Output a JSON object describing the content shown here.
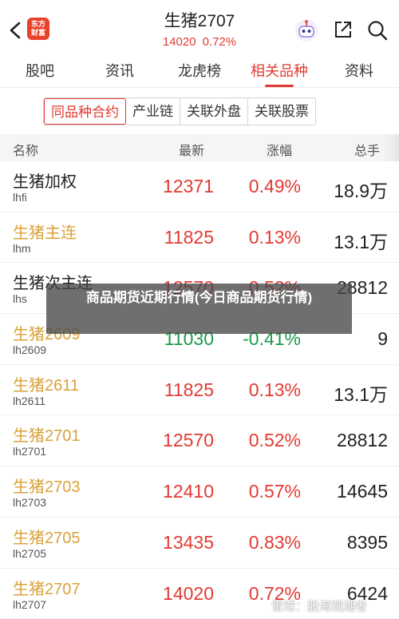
{
  "header": {
    "title": "生猪2707",
    "price": "14020",
    "change": "0.72%",
    "logo_text": "东方财富"
  },
  "tabs": [
    {
      "label": "股吧",
      "active": false
    },
    {
      "label": "资讯",
      "active": false
    },
    {
      "label": "龙虎榜",
      "active": false
    },
    {
      "label": "相关品种",
      "active": true
    },
    {
      "label": "资料",
      "active": false
    }
  ],
  "subtabs": [
    {
      "label": "同品种合约",
      "active": true
    },
    {
      "label": "产业链",
      "active": false
    },
    {
      "label": "关联外盘",
      "active": false
    },
    {
      "label": "关联股票",
      "active": false
    }
  ],
  "columns": {
    "name": "名称",
    "last": "最新",
    "change": "涨幅",
    "volume": "总手"
  },
  "rows": [
    {
      "name": "生猪加权",
      "code": "lhfi",
      "last": "12371",
      "change": "0.49%",
      "volume": "18.9万",
      "dir": "up",
      "highlight": false
    },
    {
      "name": "生猪主连",
      "code": "lhm",
      "last": "11825",
      "change": "0.13%",
      "volume": "13.1万",
      "dir": "up",
      "highlight": true
    },
    {
      "name": "生猪次主连",
      "code": "lhs",
      "last": "12570",
      "change": "0.52%",
      "volume": "28812",
      "dir": "up",
      "highlight": false
    },
    {
      "name": "生猪2609",
      "code": "lh2609",
      "last": "11030",
      "change": "-0.41%",
      "volume": "9",
      "dir": "down",
      "highlight": true
    },
    {
      "name": "生猪2611",
      "code": "lh2611",
      "last": "11825",
      "change": "0.13%",
      "volume": "13.1万",
      "dir": "up",
      "highlight": true
    },
    {
      "name": "生猪2701",
      "code": "lh2701",
      "last": "12570",
      "change": "0.52%",
      "volume": "28812",
      "dir": "up",
      "highlight": true
    },
    {
      "name": "生猪2703",
      "code": "lh2703",
      "last": "12410",
      "change": "0.57%",
      "volume": "14645",
      "dir": "up",
      "highlight": true
    },
    {
      "name": "生猪2705",
      "code": "lh2705",
      "last": "13435",
      "change": "0.83%",
      "volume": "8395",
      "dir": "up",
      "highlight": true
    },
    {
      "name": "生猪2707",
      "code": "lh2707",
      "last": "14020",
      "change": "0.72%",
      "volume": "6424",
      "dir": "up",
      "highlight": true
    }
  ],
  "overlay": {
    "text": "商品期货近期行情(今日商品期货行情)"
  },
  "watermark": "雪球：股海观潮者",
  "colors": {
    "up": "#e23a33",
    "down": "#1a9a4a",
    "highlight_name": "#d9a23a"
  }
}
